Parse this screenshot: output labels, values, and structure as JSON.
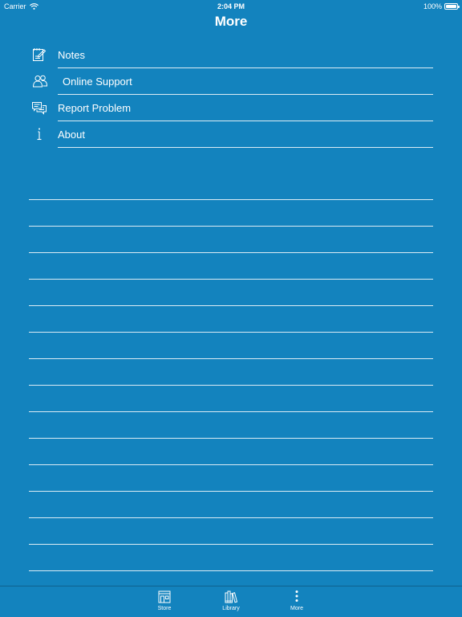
{
  "status_bar": {
    "carrier": "Carrier",
    "time": "2:04 PM",
    "battery": "100%"
  },
  "nav": {
    "title": "More"
  },
  "menu": {
    "items": [
      {
        "label": "Notes",
        "icon": "notes-icon"
      },
      {
        "label": "Online Support",
        "icon": "people-icon"
      },
      {
        "label": "Report Problem",
        "icon": "chat-bubbles-icon"
      },
      {
        "label": "About",
        "icon": "info-icon"
      }
    ]
  },
  "tab_bar": {
    "tabs": [
      {
        "label": "Store",
        "icon": "store-icon"
      },
      {
        "label": "Library",
        "icon": "books-icon"
      },
      {
        "label": "More",
        "icon": "more-icon",
        "selected": true
      }
    ]
  }
}
